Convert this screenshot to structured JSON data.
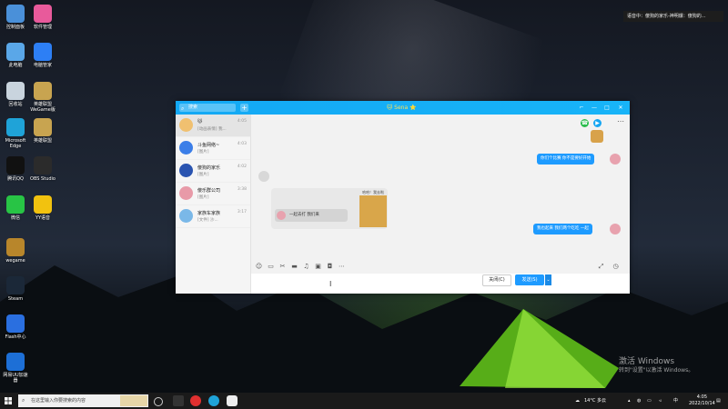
{
  "desktop": {
    "icons": [
      {
        "label": "控制面板",
        "icon": "control-panel-icon",
        "color": "#4a90d9"
      },
      {
        "label": "软件管理",
        "icon": "software-manager-icon",
        "color": "#e85a9b"
      },
      {
        "label": "此电脑",
        "icon": "this-pc-icon",
        "color": "#5aa7e8"
      },
      {
        "label": "电脑管家",
        "icon": "pc-manager-icon",
        "color": "#2d7ff5"
      },
      {
        "label": "回收站",
        "icon": "recycle-bin-icon",
        "color": "#c9d4de"
      },
      {
        "label": "英雄联盟\nWeGame版",
        "icon": "lol-wegame-icon",
        "color": "#c8a450"
      },
      {
        "label": "Microsoft\nEdge",
        "icon": "edge-icon",
        "color": "#1fa3d8"
      },
      {
        "label": "英雄联盟",
        "icon": "lol-icon",
        "color": "#c8a450"
      },
      {
        "label": "腾讯QQ",
        "icon": "qq-icon",
        "color": "#111111"
      },
      {
        "label": "OBS Studio",
        "icon": "obs-icon",
        "color": "#2b2b2b"
      },
      {
        "label": "微信",
        "icon": "wechat-icon",
        "color": "#28c445"
      },
      {
        "label": "YY语音",
        "icon": "yy-icon",
        "color": "#f2c20f"
      },
      {
        "label": "wegame",
        "icon": "wegame-icon",
        "color": "#b8862b"
      },
      {
        "label": "Steam",
        "icon": "steam-icon",
        "color": "#1b2838"
      },
      {
        "label": "Flash中心",
        "icon": "flash-center-icon",
        "color": "#2a6fe0"
      },
      {
        "label": "网易UU加速\n器",
        "icon": "uu-accelerator-icon",
        "color": "#1d6fd6"
      }
    ]
  },
  "notification": {
    "text": "语音中：傻狗的家乐-神明爆：傻狗的..."
  },
  "qq": {
    "search_placeholder": "搜索",
    "plus_label": "+",
    "chat_title": "🐱 Sena ⭐",
    "window_controls": [
      "—",
      "□",
      "✕",
      "⌐",
      "—"
    ],
    "conversations": [
      {
        "name": "🐱",
        "preview": "[动画表情] 我...",
        "time": "4:05",
        "color": "#f0c070",
        "active": true
      },
      {
        "name": "斗鱼网络~",
        "preview": "[图片]",
        "time": "4:03",
        "color": "#3b7ee8",
        "active": false
      },
      {
        "name": "傻狗的家乐",
        "preview": "[图片]",
        "time": "4:02",
        "color": "#2a54b0",
        "active": false
      },
      {
        "name": "傻乐群公司",
        "preview": "[图片]",
        "time": "3:38",
        "color": "#e89aa8",
        "active": false
      },
      {
        "name": "家族车家族",
        "preview": "[文件] 沙...",
        "time": "3:17",
        "color": "#7ab8e8",
        "active": false
      }
    ],
    "messages": [
      {
        "side": "right",
        "text": "你们个比赛 你不是要好开始"
      },
      {
        "side": "right",
        "text": "我也起来 我们两个吃吃 一起"
      }
    ],
    "quote": {
      "caption": "哈哈！我去啦",
      "inner": "一起去打 我们来"
    },
    "toolbar_icons": [
      "emoji-icon",
      "gif-icon",
      "scissors-icon",
      "folder-icon",
      "music-icon",
      "image-icon",
      "screen-icon",
      "more-icon"
    ],
    "close_label": "关闭(C)",
    "send_label": "发送(S)",
    "send_arrow": "⌄"
  },
  "watermark": {
    "line1": "激活 Windows",
    "line2": "转到\"设置\"以激活 Windows。"
  },
  "taskbar": {
    "search_placeholder": "在这里输入你要搜索的内容",
    "weather": "14°C 多云",
    "ime": "中",
    "time": "4:05",
    "date": "2022/10/14"
  },
  "colors": {
    "qq_blue": "#13a8f4",
    "send_blue": "#1e9bff"
  }
}
